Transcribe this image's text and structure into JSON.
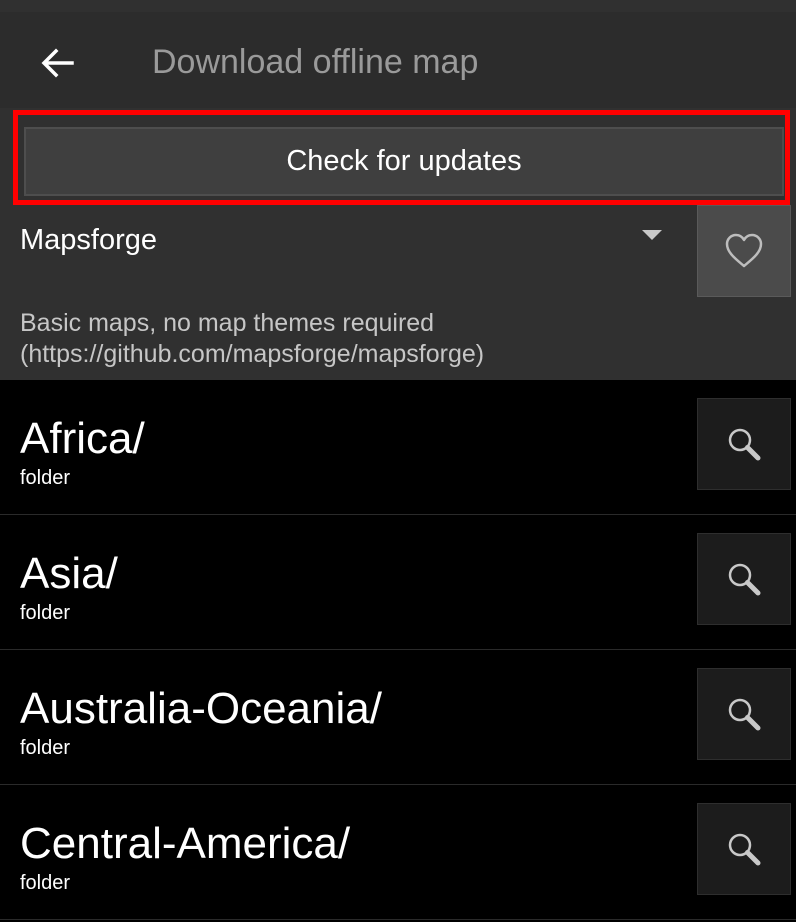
{
  "header": {
    "title": "Download offline map",
    "back_icon": "arrow-left-icon"
  },
  "actions": {
    "check_updates_label": "Check for updates",
    "highlight_color": "#ff0000"
  },
  "source": {
    "selected": "Mapsforge",
    "description_line1": "Basic maps, no map themes required",
    "description_line2": "(https://github.com/mapsforge/mapsforge)",
    "favorite_icon": "heart-outline-icon"
  },
  "folders": [
    {
      "name": "Africa/",
      "type": "folder",
      "action_icon": "search-icon"
    },
    {
      "name": "Asia/",
      "type": "folder",
      "action_icon": "search-icon"
    },
    {
      "name": "Australia-Oceania/",
      "type": "folder",
      "action_icon": "search-icon"
    },
    {
      "name": "Central-America/",
      "type": "folder",
      "action_icon": "search-icon"
    }
  ],
  "colors": {
    "background": "#000000",
    "panel": "#303030",
    "button": "#3f3f3f",
    "title_text": "#9a9a9a"
  }
}
